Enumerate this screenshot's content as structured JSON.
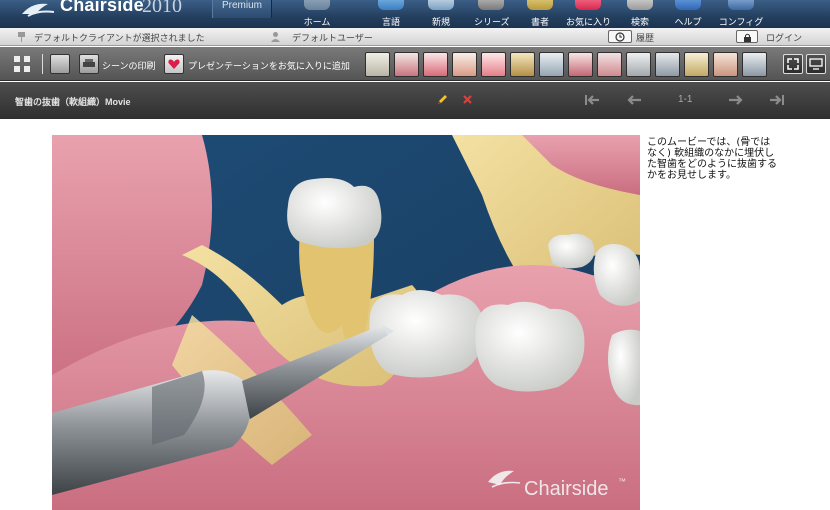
{
  "app": {
    "brand": "Chairside",
    "year": "2010",
    "edition": "Premium"
  },
  "nav": {
    "home": "ホーム",
    "language": "言語",
    "new": "新規",
    "series": "シリーズ",
    "notes": "書者",
    "favorites": "お気に入り",
    "search": "検索",
    "help": "ヘルプ",
    "config": "コンフィグ"
  },
  "status": {
    "client": "デフォルトクライアントが選択されました",
    "user": "デフォルトユーザー",
    "history": "履歴",
    "login": "ログイン"
  },
  "toolbar": {
    "print_scene": "シーンの印刷",
    "add_favorite": "プレゼンテーションをお気に入りに追加"
  },
  "scene": {
    "title": "智歯の抜歯（軟組織）Movie",
    "page": "1-1"
  },
  "description": "このムービーでは、(骨ではなく) 軟組織のなかに埋伏した智歯をどのように抜歯するかをお見せします。",
  "watermark": "Chairside",
  "watermark_tm": "™"
}
